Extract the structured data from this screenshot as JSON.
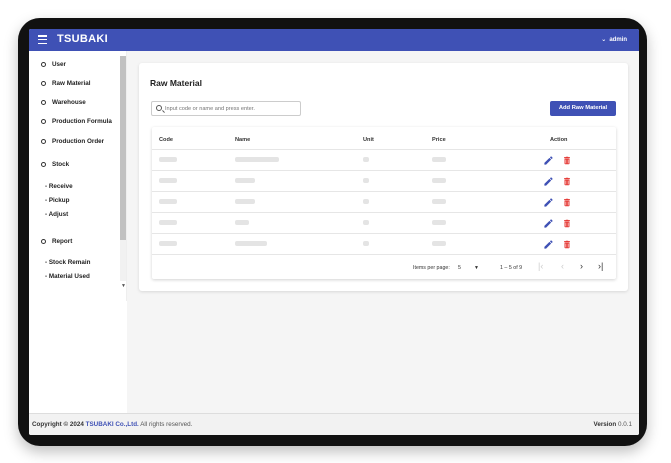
{
  "app": {
    "title": "TSUBAKI",
    "user": "admin"
  },
  "colors": {
    "primary": "#3f51b5",
    "danger": "#e53935"
  },
  "sidebar": {
    "items": [
      {
        "label": "User"
      },
      {
        "label": "Raw Material"
      },
      {
        "label": "Warehouse"
      },
      {
        "label": "Production Formula"
      },
      {
        "label": "Production Order"
      },
      {
        "label": "Stock"
      },
      {
        "label": "Report"
      }
    ],
    "stock_sub": [
      "- Receive",
      "- Pickup",
      "- Adjust"
    ],
    "report_sub": [
      "- Stock Remain",
      "- Material Used"
    ]
  },
  "page": {
    "title": "Raw Material",
    "search_placeholder": "Input code or name and press enter.",
    "add_button": "Add Raw Material"
  },
  "table": {
    "headers": {
      "code": "Code",
      "name": "Name",
      "unit": "Unit",
      "price": "Price",
      "action": "Action"
    },
    "rows_count": 5,
    "row_icons": [
      "edit-icon",
      "delete-icon"
    ]
  },
  "paginator": {
    "items_per_page_label": "Items per page:",
    "page_size": "5",
    "range": "1 – 5 of 9"
  },
  "footer": {
    "copyright_prefix": "Copyright © 2024",
    "company": "TSUBAKI Co.,Ltd.",
    "rights": "All rights reserved.",
    "version_label": "Version",
    "version": "0.0.1"
  }
}
